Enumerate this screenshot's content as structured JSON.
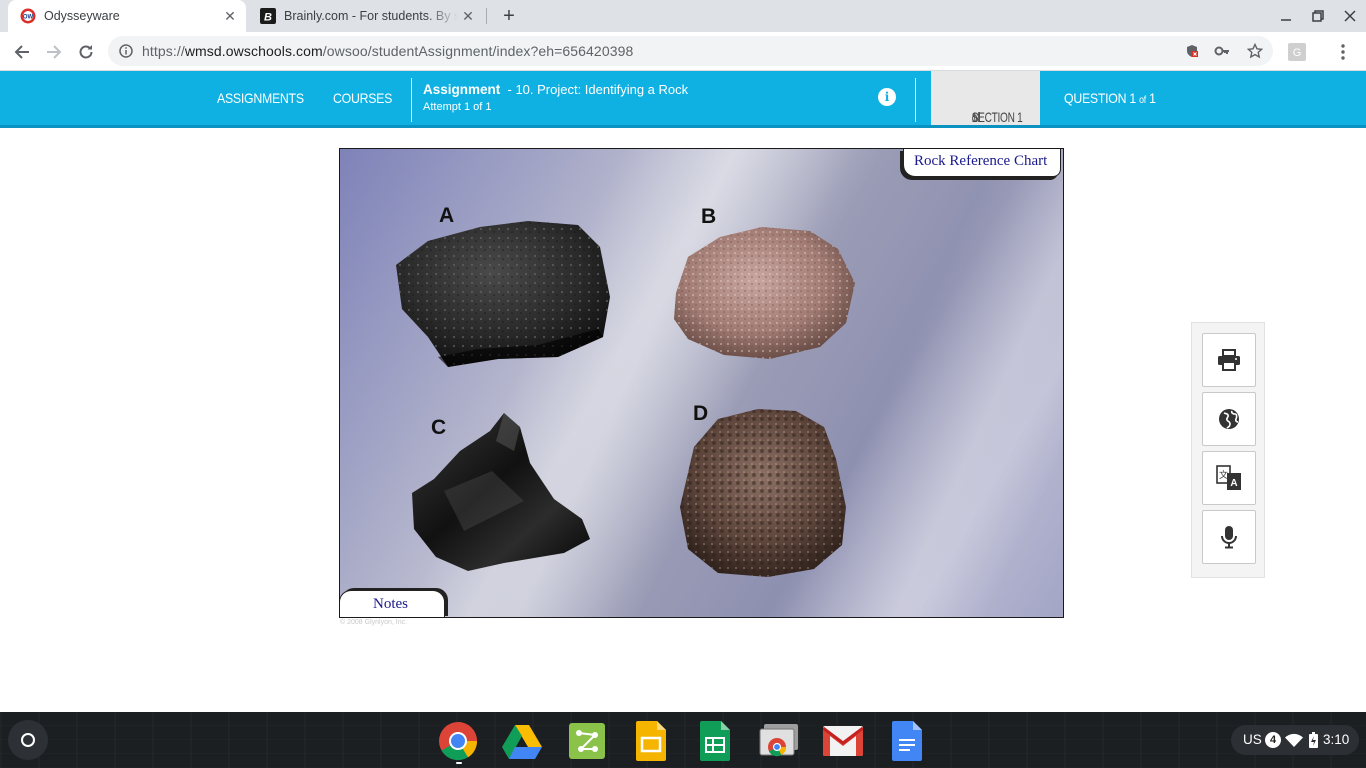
{
  "browser": {
    "tabs": [
      {
        "title": "Odysseyware",
        "active": true
      },
      {
        "title": "Brainly.com - For students. By students",
        "active": false
      }
    ],
    "url_prefix": "https://",
    "url_host": "wmsd.owschools.com",
    "url_path": "/owsoo/studentAssignment/index?eh=656420398"
  },
  "header": {
    "nav": {
      "assignments": "ASSIGNMENTS",
      "courses": "COURSES"
    },
    "assignment_label": "Assignment",
    "assignment_name": "- 10. Project: Identifying a Rock",
    "attempt": "Attempt 1 of 1",
    "info_glyph": "i",
    "section": {
      "label": "SECTION 1",
      "of": "of",
      "total": "1"
    },
    "question": {
      "label": "QUESTION 1",
      "of": "of",
      "total": "1"
    }
  },
  "content": {
    "reference_tab": "Rock Reference Chart",
    "notes_tab": "Notes",
    "rocks": [
      {
        "label": "A",
        "description": "dark porous rock"
      },
      {
        "label": "B",
        "description": "pink granular rock"
      },
      {
        "label": "C",
        "description": "black glassy rock"
      },
      {
        "label": "D",
        "description": "brown vesicular rock"
      }
    ],
    "copyright": "© 2008 Glynlyon, Inc."
  },
  "toolbox": {
    "icons": [
      "print-icon",
      "globe-icon",
      "translate-icon",
      "microphone-icon"
    ]
  },
  "shelf": {
    "apps": [
      "chrome-icon",
      "drive-icon",
      "classroom-icon",
      "slides-icon",
      "sheets-icon",
      "screencast-icon",
      "gmail-icon",
      "docs-icon"
    ],
    "tray": {
      "keyboard": "US",
      "notifications": "4",
      "time": "3:10"
    }
  },
  "colors": {
    "header_blue": "#0fb1e2",
    "link_navy": "#1a1a8c",
    "shelf": "#1c1f22"
  }
}
